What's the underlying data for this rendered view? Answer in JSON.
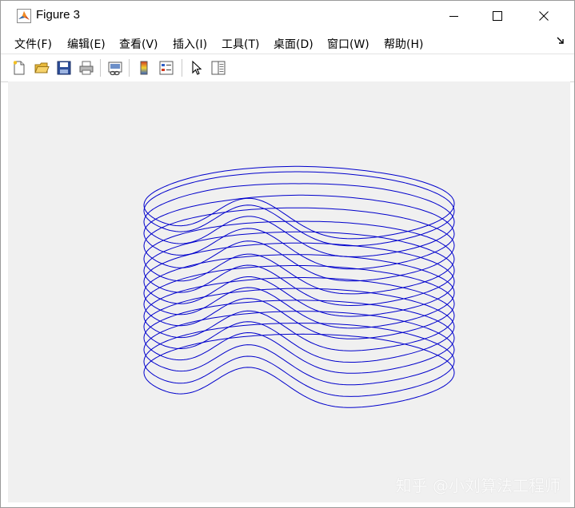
{
  "window": {
    "title": "Figure 3",
    "icons": {
      "app": "matlab-logo-icon",
      "minimize": "minimize-icon",
      "maximize": "maximize-icon",
      "close": "close-icon",
      "dock": "dock-arrow-icon"
    }
  },
  "menubar": {
    "items": [
      "文件(F)",
      "编辑(E)",
      "查看(V)",
      "插入(I)",
      "工具(T)",
      "桌面(D)",
      "窗口(W)",
      "帮助(H)"
    ]
  },
  "toolbar": {
    "buttons": [
      {
        "icon": "new-figure-icon"
      },
      {
        "icon": "open-file-icon"
      },
      {
        "icon": "save-icon"
      },
      {
        "icon": "print-icon"
      },
      {
        "icon": "link-plot-icon"
      },
      {
        "icon": "insert-colorbar-icon"
      },
      {
        "icon": "insert-legend-icon"
      },
      {
        "icon": "edit-plot-pointer-icon"
      },
      {
        "icon": "property-inspector-icon"
      }
    ]
  },
  "figure": {
    "background": "#f0f0f0",
    "line_color": "#0000cc",
    "watermark": "知乎 @小刘算法工程师"
  },
  "chart_data": {
    "type": "line",
    "title": "",
    "xlabel": "",
    "ylabel": "",
    "grid": false,
    "legend": "none",
    "description_of_marks": "stacked closed curves forming a cylindrical surface with a single Gaussian-like bump",
    "series": [
      {
        "values": [
          0.0,
          0.039,
          0.052,
          0.035,
          0.033,
          0.059,
          0.046,
          0.029,
          0.009,
          0.004,
          0.016,
          0.019,
          0.013
        ]
      },
      {
        "values": [
          0.074,
          0.076,
          0.063,
          0.05,
          0.048,
          0.071,
          0.068,
          0.05,
          0.052,
          0.061,
          0.071,
          0.066,
          0.072
        ]
      },
      {
        "values": [
          0.129,
          0.126,
          0.115,
          0.132,
          0.114,
          0.139,
          0.127,
          0.136,
          0.128,
          0.109,
          0.134,
          0.142,
          0.131
        ]
      },
      {
        "values": [
          0.207,
          0.186,
          0.196,
          0.19,
          0.211,
          0.201,
          0.184,
          0.193,
          0.189,
          0.203,
          0.203,
          0.192,
          0.201
        ]
      },
      {
        "values": [
          0.253,
          0.272,
          0.277,
          0.271,
          0.265,
          0.256,
          0.263,
          0.269,
          0.281,
          0.261,
          0.27,
          0.28,
          0.255
        ]
      },
      {
        "values": [
          0.35,
          0.327,
          0.34,
          0.357,
          0.344,
          0.339,
          0.337,
          0.347,
          0.355,
          0.333,
          0.34,
          0.351,
          0.336
        ]
      },
      {
        "values": [
          0.399,
          0.413,
          0.397,
          0.403,
          0.4,
          0.406,
          0.418,
          0.42,
          0.409,
          0.406,
          0.411,
          0.405,
          0.421
        ]
      },
      {
        "values": [
          0.47,
          0.463,
          0.474,
          0.466,
          0.471,
          0.475,
          0.473,
          0.482,
          0.487,
          0.469,
          0.466,
          0.475,
          0.474
        ]
      },
      {
        "values": [
          0.525,
          0.547,
          0.545,
          0.536,
          0.53,
          0.546,
          0.542,
          0.539,
          0.533,
          0.534,
          0.547,
          0.538,
          0.538
        ]
      },
      {
        "values": [
          0.596,
          0.603,
          0.614,
          0.599,
          0.594,
          0.614,
          0.607,
          0.608,
          0.593,
          0.593,
          0.602,
          0.598,
          0.604
        ]
      },
      {
        "values": [
          0.662,
          0.678,
          0.67,
          0.669,
          0.679,
          0.672,
          0.678,
          0.665,
          0.679,
          0.668,
          0.665,
          0.68,
          0.66
        ]
      },
      {
        "values": [
          0.734,
          0.741,
          0.731,
          0.73,
          0.739,
          0.745,
          0.726,
          0.74,
          0.729,
          0.74,
          0.742,
          0.725,
          0.723
        ]
      },
      {
        "values": [
          0.797,
          0.799,
          0.807,
          0.808,
          0.802,
          0.8,
          0.79,
          0.806,
          0.793,
          0.791,
          0.805,
          0.796,
          0.797
        ]
      },
      {
        "values": [
          0.871,
          0.871,
          0.857,
          0.863,
          0.869,
          0.866,
          0.866,
          0.854,
          0.873,
          0.869,
          0.867,
          0.866,
          0.861
        ]
      },
      {
        "values": [
          0.928,
          0.934,
          0.923,
          0.937,
          0.93,
          0.925,
          0.937,
          0.941,
          0.935,
          0.934,
          0.938,
          0.933,
          0.929
        ]
      },
      {
        "values": [
          1.0,
          0.998,
          0.985,
          0.998,
          0.997,
          1.001,
          0.998,
          0.991,
          0.994,
          1.007,
          0.994,
          0.989,
          1.006
        ]
      }
    ],
    "bump": {
      "center_angle_deg": 252,
      "width_deg": 14,
      "height": 0.24
    }
  }
}
